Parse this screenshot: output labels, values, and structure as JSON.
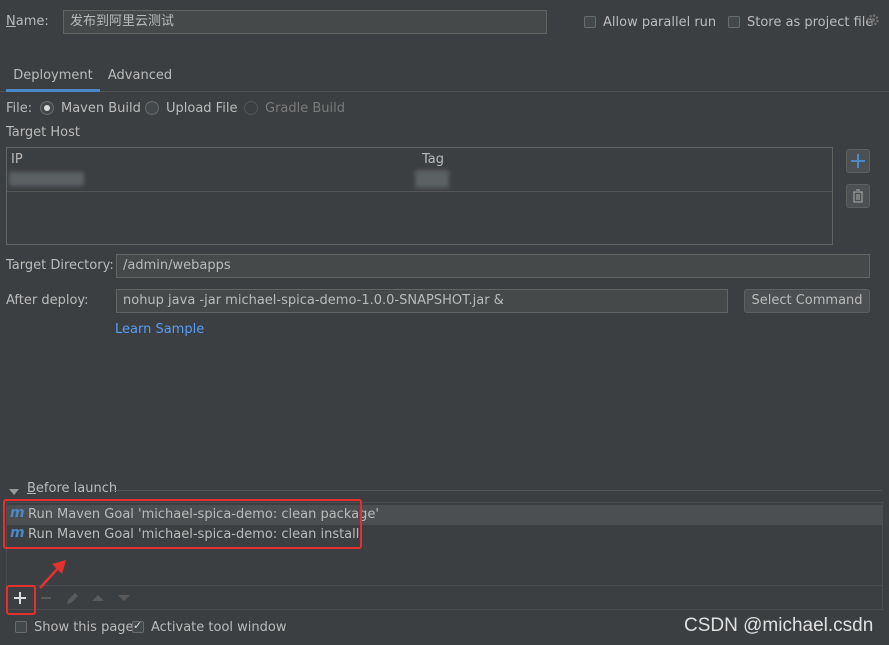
{
  "header": {
    "name_label": "Name:",
    "name_value": "发布到阿里云测试",
    "allow_parallel_label": "Allow parallel run",
    "store_as_project_label": "Store as project file"
  },
  "tabs": [
    {
      "label": "Deployment",
      "active": true
    },
    {
      "label": "Advanced",
      "active": false
    }
  ],
  "file": {
    "label": "File:",
    "options": [
      {
        "label": "Maven Build",
        "selected": true,
        "enabled": true
      },
      {
        "label": "Upload File",
        "selected": false,
        "enabled": true
      },
      {
        "label": "Gradle Build",
        "selected": false,
        "enabled": false
      }
    ]
  },
  "target_host": {
    "label": "Target Host",
    "columns": [
      "IP",
      "Tag"
    ]
  },
  "target_directory": {
    "label": "Target Directory:",
    "value": "/admin/webapps"
  },
  "after_deploy": {
    "label": "After deploy:",
    "value": "nohup java -jar michael-spica-demo-1.0.0-SNAPSHOT.jar &",
    "select_command_label": "Select Command",
    "learn_sample_label": "Learn Sample"
  },
  "before_launch": {
    "title": "Before launch",
    "items": [
      "Run Maven Goal 'michael-spica-demo: clean package'",
      "Run Maven Goal 'michael-spica-demo: clean install'"
    ]
  },
  "footer": {
    "show_page_label": "Show this page",
    "activate_tool_label": "Activate tool window",
    "watermark": "CSDN @michael.csdn"
  },
  "colors": {
    "background": "#3c3f41",
    "accent_blue": "#4a88c7",
    "link": "#589df6",
    "annotation_red": "#e53030"
  }
}
